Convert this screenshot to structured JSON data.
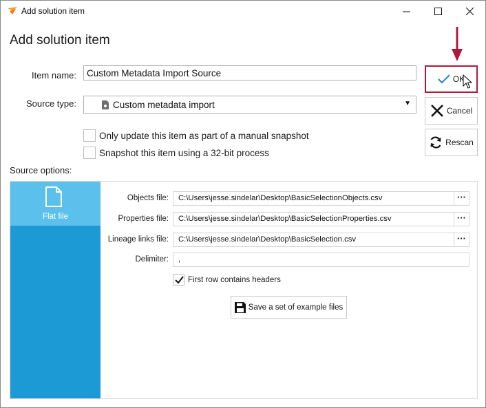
{
  "window": {
    "title": "Add solution item",
    "minimize_glyph": "—",
    "maximize_glyph": "☐",
    "close_glyph": "✕"
  },
  "heading": "Add solution item",
  "form": {
    "item_name_label": "Item name:",
    "item_name_value": "Custom Metadata Import Source",
    "source_type_label": "Source type:",
    "source_type_value": "Custom metadata import",
    "checkbox_manual_snapshot": {
      "label": "Only update this item as part of a manual snapshot",
      "checked": false
    },
    "checkbox_32bit": {
      "label": "Snapshot this item using a 32-bit process",
      "checked": false
    },
    "source_options_label": "Source options:"
  },
  "buttons": {
    "ok": "OK",
    "cancel": "Cancel",
    "rescan": "Rescan"
  },
  "source_options": {
    "tab_label": "Flat file",
    "tab_icon": "document-icon",
    "objects_file_label": "Objects file:",
    "objects_file_value": "C:\\Users\\jesse.sindelar\\Desktop\\BasicSelectionObjects.csv",
    "properties_file_label": "Properties file:",
    "properties_file_value": "C:\\Users\\jesse.sindelar\\Desktop\\BasicSelectionProperties.csv",
    "lineage_file_label": "Lineage links file:",
    "lineage_file_value": "C:\\Users\\jesse.sindelar\\Desktop\\BasicSelection.csv",
    "browse_label": "···",
    "delimiter_label": "Delimiter:",
    "delimiter_value": ",",
    "first_row_headers": {
      "label": "First row contains headers",
      "checked": true
    },
    "save_examples_label": "Save a set of example files"
  },
  "colors": {
    "accent_blue": "#1b9ad6",
    "tab_selected": "#5bc0eb",
    "highlight_red": "#b0183a",
    "ok_check": "#2a8ad4"
  }
}
